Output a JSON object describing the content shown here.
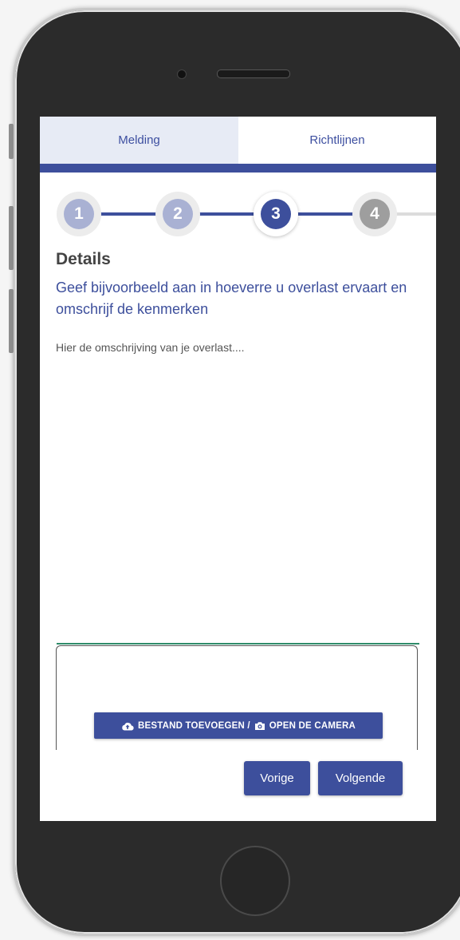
{
  "tabs": [
    {
      "label": "Melding",
      "active": true
    },
    {
      "label": "Richtlijnen",
      "active": false
    }
  ],
  "stepper": {
    "steps": [
      "1",
      "2",
      "3",
      "4"
    ],
    "current": 3
  },
  "form": {
    "title": "Details",
    "subtitle": "Geef bijvoorbeeld aan in hoeverre u overlast ervaart en omschrijf de kenmerken",
    "description_placeholder": "Hier de omschrijving van je overlast...."
  },
  "upload": {
    "file_label": "BESTAND TOEVOEGEN /",
    "camera_label": "OPEN DE CAMERA",
    "file_icon": "cloud-upload-icon",
    "camera_icon": "camera-icon"
  },
  "navigation": {
    "prev_label": "Vorige",
    "next_label": "Volgende"
  },
  "colors": {
    "accent": "#3d4f9c",
    "tab_active_bg": "#e7ebf5",
    "step_done": "#a9b1d3",
    "step_todo": "#9e9e9e",
    "input_underline": "#2f8c6a"
  }
}
